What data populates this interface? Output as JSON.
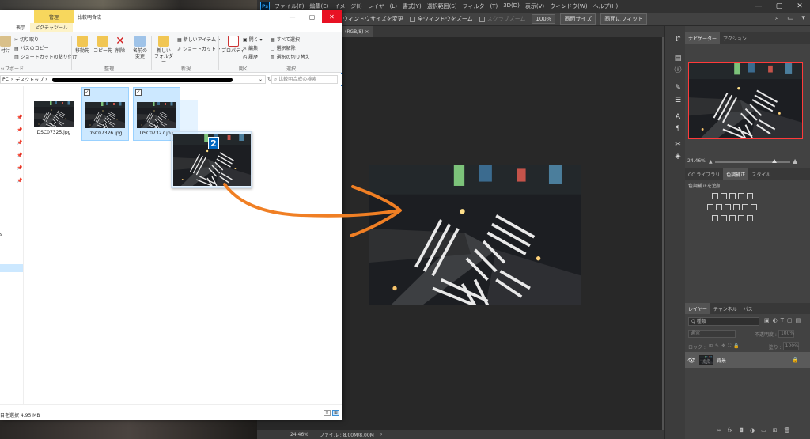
{
  "photoshop": {
    "logo": "Ps",
    "menu": [
      "ファイル(F)",
      "編集(E)",
      "イメージ(I)",
      "レイヤー(L)",
      "書式(Y)",
      "選択範囲(S)",
      "フィルター(T)",
      "3D(D)",
      "表示(V)",
      "ウィンドウ(W)",
      "ヘルプ(H)"
    ],
    "options": {
      "resize_windows": "ウィンドウサイズを変更",
      "zoom_all": "全ウィンドウをズーム",
      "scrubby_zoom": "スクラブズーム",
      "zoom_value": "100%",
      "fit_screen": "画面サイズ",
      "fill_screen": "画面にフィット"
    },
    "document_tab": "(RGB/8)",
    "status": {
      "zoom": "24.46%",
      "file": "ファイル : 8.00M/8.00M"
    },
    "navigator": {
      "tabs": [
        "ナビゲーター",
        "アクション"
      ],
      "zoom": "24.46%"
    },
    "adjustments": {
      "tabs": [
        "CC ライブラリ",
        "色調補正",
        "スタイル"
      ],
      "label": "色調補正を追加"
    },
    "layers": {
      "tabs": [
        "レイヤー",
        "チャンネル",
        "パス"
      ],
      "search": "Q 種類",
      "blend_mode": "通常",
      "opacity_label": "不透明度 :",
      "opacity": "100%",
      "lock_label": "ロック :",
      "fill_label": "塗り :",
      "fill": "100%",
      "layer_name": "背景"
    }
  },
  "explorer": {
    "manage_tab": "管理",
    "title": "比較明合成",
    "ribbon_tabs": [
      "表示",
      "ピクチャツール"
    ],
    "clipboard": {
      "cut": "切り取り",
      "copy_path": "パスのコピー",
      "paste_shortcut": "ショートカットの貼り付け",
      "paste_tail": "付け",
      "group": "ップボード"
    },
    "organize": {
      "move_to": "移動先",
      "copy_to": "コピー先",
      "delete": "削除",
      "rename": "名前の変更",
      "group": "整理"
    },
    "new": {
      "new_folder": "新しい フォルダー",
      "new_item": "新しいアイテム ▾",
      "shortcut": "ショートカット ▾",
      "group": "新規"
    },
    "open": {
      "properties": "プロパティ",
      "open": "開く ▾",
      "edit": "編集",
      "history": "履歴",
      "group": "開く"
    },
    "select": {
      "select_all": "すべて選択",
      "select_none": "選択解除",
      "invert": "選択の切り替え",
      "group": "選択"
    },
    "address": {
      "pc": "PC",
      "desktop": "デスクトップ"
    },
    "search_placeholder": "比較明合成の検索",
    "files": [
      {
        "name": "DSC07325.jpg",
        "selected": false
      },
      {
        "name": "DSC07326.jpg",
        "selected": true
      },
      {
        "name": "DSC07327.jpg",
        "selected": true
      }
    ],
    "drag_count": "2",
    "nav_partial": [
      "ー",
      "s"
    ],
    "status": "目を選択  4.95 MB"
  },
  "colors": {
    "arrow": "#f07f24",
    "selection": "#cce8ff",
    "ps_bg": "#282828",
    "close_red": "#e81123"
  }
}
